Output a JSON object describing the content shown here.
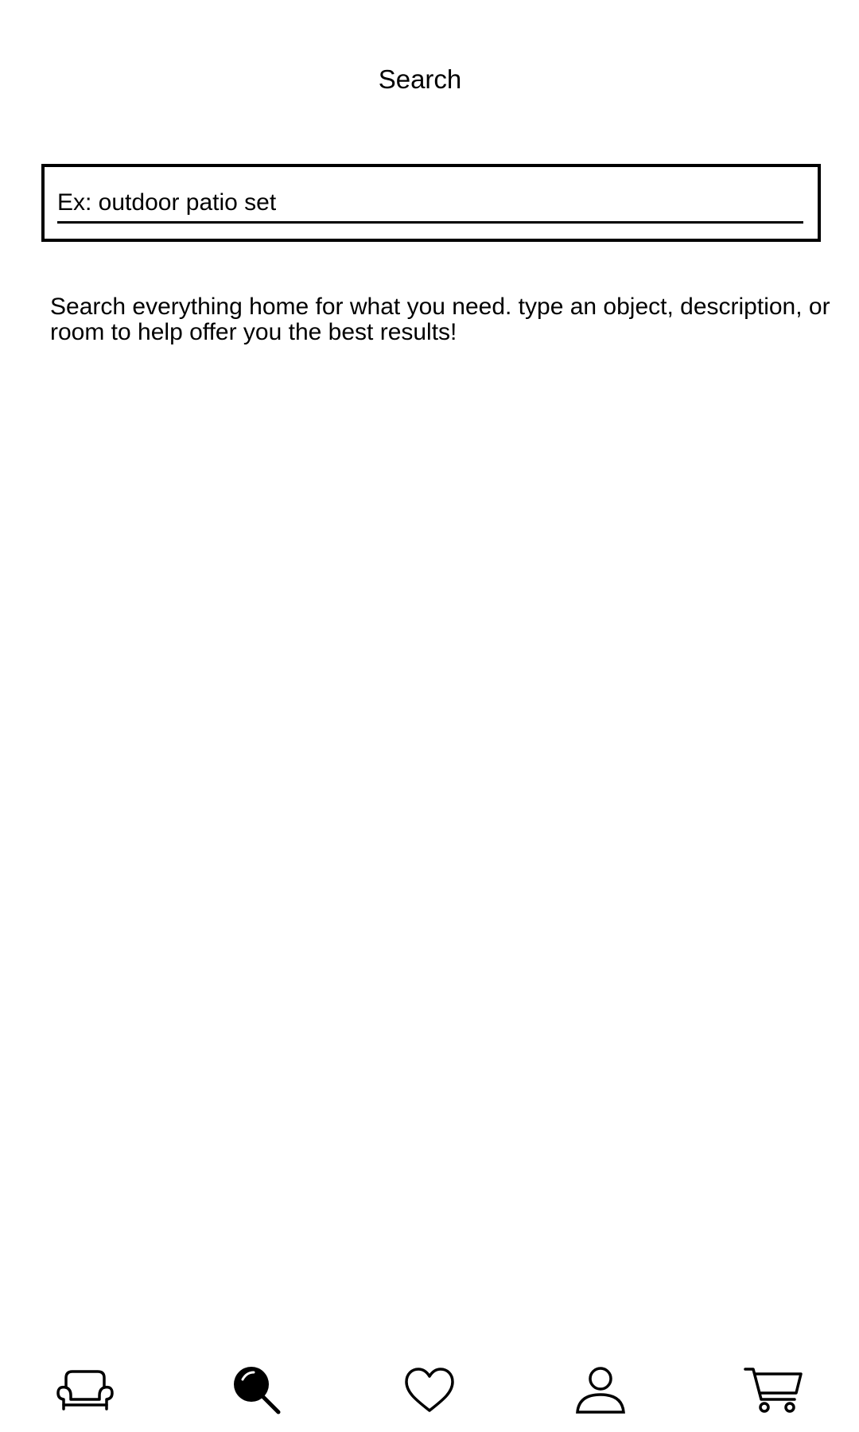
{
  "header": {
    "title": "Search"
  },
  "search": {
    "placeholder": "Ex: outdoor patio set",
    "value": ""
  },
  "help_text": "Search everything home for what you need. type an object, description, or room to help offer you the best results!",
  "bottom_nav": {
    "active": "search",
    "items": [
      {
        "id": "home",
        "icon": "sofa-icon"
      },
      {
        "id": "search",
        "icon": "search-icon"
      },
      {
        "id": "favorites",
        "icon": "heart-icon"
      },
      {
        "id": "profile",
        "icon": "user-icon"
      },
      {
        "id": "cart",
        "icon": "cart-icon"
      }
    ]
  },
  "colors": {
    "foreground": "#000000",
    "background": "#ffffff"
  }
}
